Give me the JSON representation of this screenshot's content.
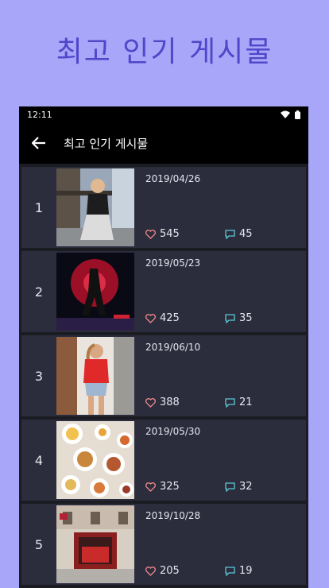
{
  "promo_title": "최고 인기 게시물",
  "status_bar": {
    "time": "12:11",
    "wifi_icon": "wifi-icon",
    "battery_icon": "battery-icon"
  },
  "app_bar": {
    "back_icon": "arrow-left-icon",
    "title": "최고 인기 게시물"
  },
  "colors": {
    "heart": "#f08a8a",
    "comment": "#5bc8d6",
    "background": "#a8a6f8",
    "accent": "#4f47c9"
  },
  "posts": [
    {
      "rank": "1",
      "date": "2019/04/26",
      "likes": "545",
      "comments": "45",
      "image": "woman-sportswear-photo"
    },
    {
      "rank": "2",
      "date": "2019/05/23",
      "likes": "425",
      "comments": "35",
      "image": "dancer-red-light-photo"
    },
    {
      "rank": "3",
      "date": "2019/06/10",
      "likes": "388",
      "comments": "21",
      "image": "woman-red-shirt-photo"
    },
    {
      "rank": "4",
      "date": "2019/05/30",
      "likes": "325",
      "comments": "32",
      "image": "brunch-table-photo"
    },
    {
      "rank": "5",
      "date": "2019/10/28",
      "likes": "205",
      "comments": "19",
      "image": "fire-station-photo"
    }
  ]
}
